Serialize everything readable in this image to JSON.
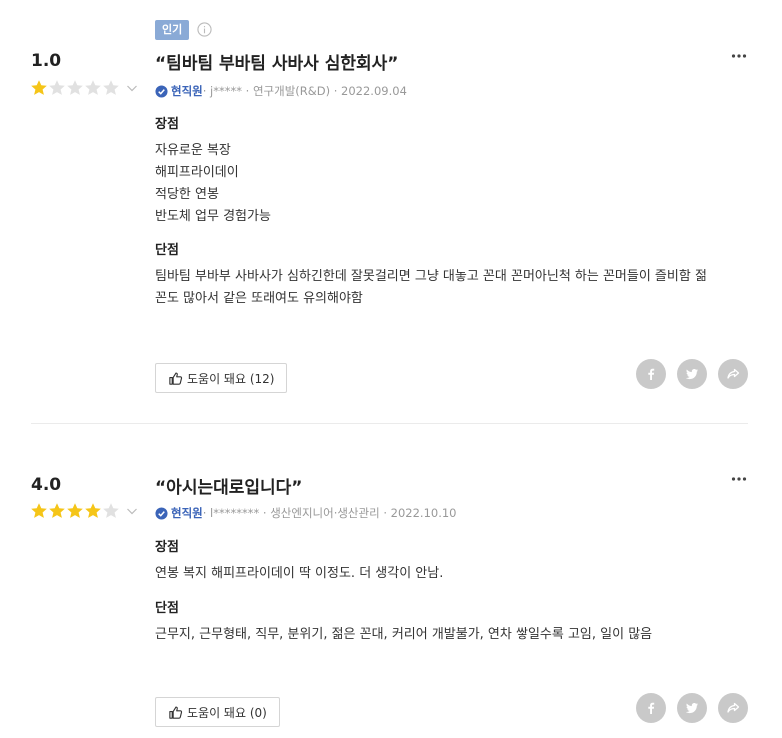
{
  "reviews": [
    {
      "badge": "인기",
      "score": "1.0",
      "rating": 1,
      "title": "“팀바팀 부바팀 사바사 심한회사”",
      "status": "현직원",
      "user": " · j***** · 연구개발(R&D) · 2022.09.04",
      "pros_label": "장점",
      "pros": [
        "자유로운 복장",
        "해피프라이데이",
        "적당한 연봉",
        "반도체 업무 경험가능"
      ],
      "cons_label": "단점",
      "cons": [
        "팀바팀 부바부 사바사가 심하긴한데 잘못걸리면 그냥 대놓고 꼰대 꼰머아닌척 하는 꼰머들이 즐비함 젊",
        "꼰도 많아서 같은 또래여도 유의해야함"
      ],
      "helpful": "도움이 돼요 (12)"
    },
    {
      "score": "4.0",
      "rating": 4,
      "title": "“아시는대로입니다”",
      "status": "현직원",
      "user": " · l******** · 생산엔지니어·생산관리 · 2022.10.10",
      "pros_label": "장점",
      "pros": [
        "연봉 복지 해피프라이데이 딱 이정도. 더 생각이 안남."
      ],
      "cons_label": "단점",
      "cons": [
        "근무지, 근무형태, 직무, 분위기, 젊은 꼰대, 커리어 개발불가, 연차 쌓일수록 고임, 일이 많음"
      ],
      "helpful": "도움이 돼요 (0)"
    }
  ],
  "colors": {
    "star_on": "#f5c518",
    "star_off": "#e1e1e1",
    "status": "#3b64b8",
    "badge": "#8aaad6",
    "share_bg": "#c9c9c9"
  },
  "icons": {
    "facebook": "facebook-icon",
    "twitter": "twitter-icon",
    "share": "share-icon",
    "thumb": "thumb-up-icon",
    "more": "more-icon",
    "info": "info-icon",
    "verified": "verified-icon",
    "chevron": "chevron-down-icon"
  }
}
